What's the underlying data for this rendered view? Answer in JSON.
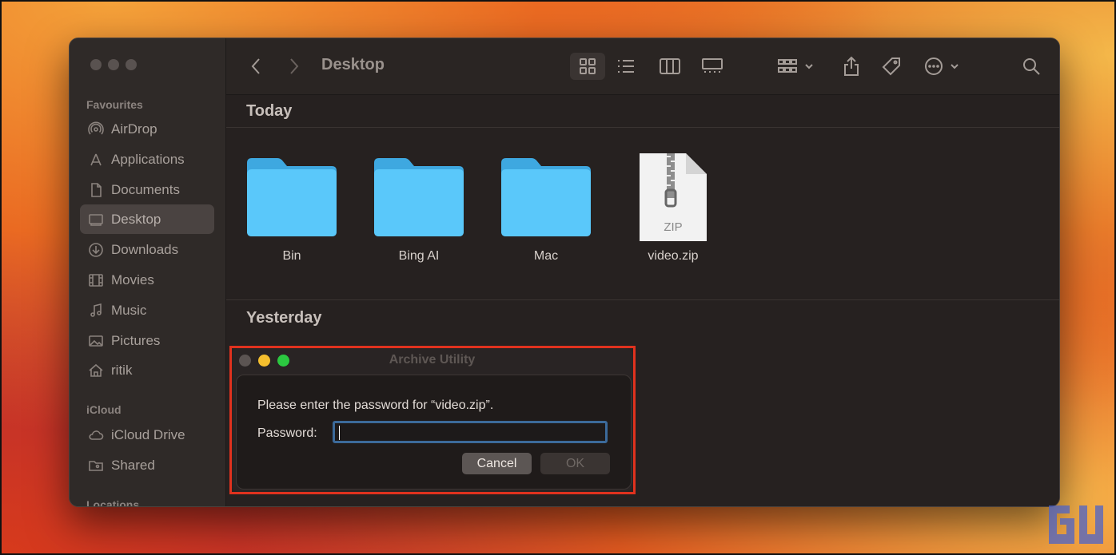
{
  "colors": {
    "folder_blue": "#5ac8fa",
    "highlight_red": "#e0321e",
    "traffic_yellow": "#f5bf2e",
    "traffic_green": "#2bc840"
  },
  "finder": {
    "toolbar": {
      "title": "Desktop",
      "back_icon": "chevron-left-icon",
      "forward_icon": "chevron-right-icon",
      "view_icons": [
        "icon-view-icon",
        "list-view-icon",
        "column-view-icon",
        "gallery-view-icon"
      ],
      "group_icon": "group-icon",
      "share_icon": "share-icon",
      "tag_icon": "tag-icon",
      "more_icon": "more-icon",
      "search_icon": "search-icon"
    },
    "sidebar": {
      "favourites_heading": "Favourites",
      "favourites": [
        {
          "label": "AirDrop",
          "icon": "airdrop-icon"
        },
        {
          "label": "Applications",
          "icon": "applications-icon"
        },
        {
          "label": "Documents",
          "icon": "document-icon"
        },
        {
          "label": "Desktop",
          "icon": "desktop-icon",
          "active": true
        },
        {
          "label": "Downloads",
          "icon": "download-icon"
        },
        {
          "label": "Movies",
          "icon": "film-icon"
        },
        {
          "label": "Music",
          "icon": "music-icon"
        },
        {
          "label": "Pictures",
          "icon": "photo-icon"
        },
        {
          "label": "ritik",
          "icon": "home-icon"
        }
      ],
      "icloud_heading": "iCloud",
      "icloud": [
        {
          "label": "iCloud Drive",
          "icon": "cloud-icon"
        },
        {
          "label": "Shared",
          "icon": "shared-folder-icon"
        }
      ],
      "locations_heading": "Locations"
    },
    "sections": {
      "today": "Today",
      "yesterday": "Yesterday"
    },
    "files_today": [
      {
        "name": "Bin",
        "kind": "folder"
      },
      {
        "name": "Bing AI",
        "kind": "folder"
      },
      {
        "name": "Mac",
        "kind": "folder"
      },
      {
        "name": "video.zip",
        "kind": "zip",
        "badge": "ZIP"
      }
    ]
  },
  "dialog": {
    "title": "Archive Utility",
    "message": "Please enter the password for “video.zip”.",
    "password_label": "Password:",
    "password_value": "",
    "cancel_label": "Cancel",
    "ok_label": "OK"
  }
}
